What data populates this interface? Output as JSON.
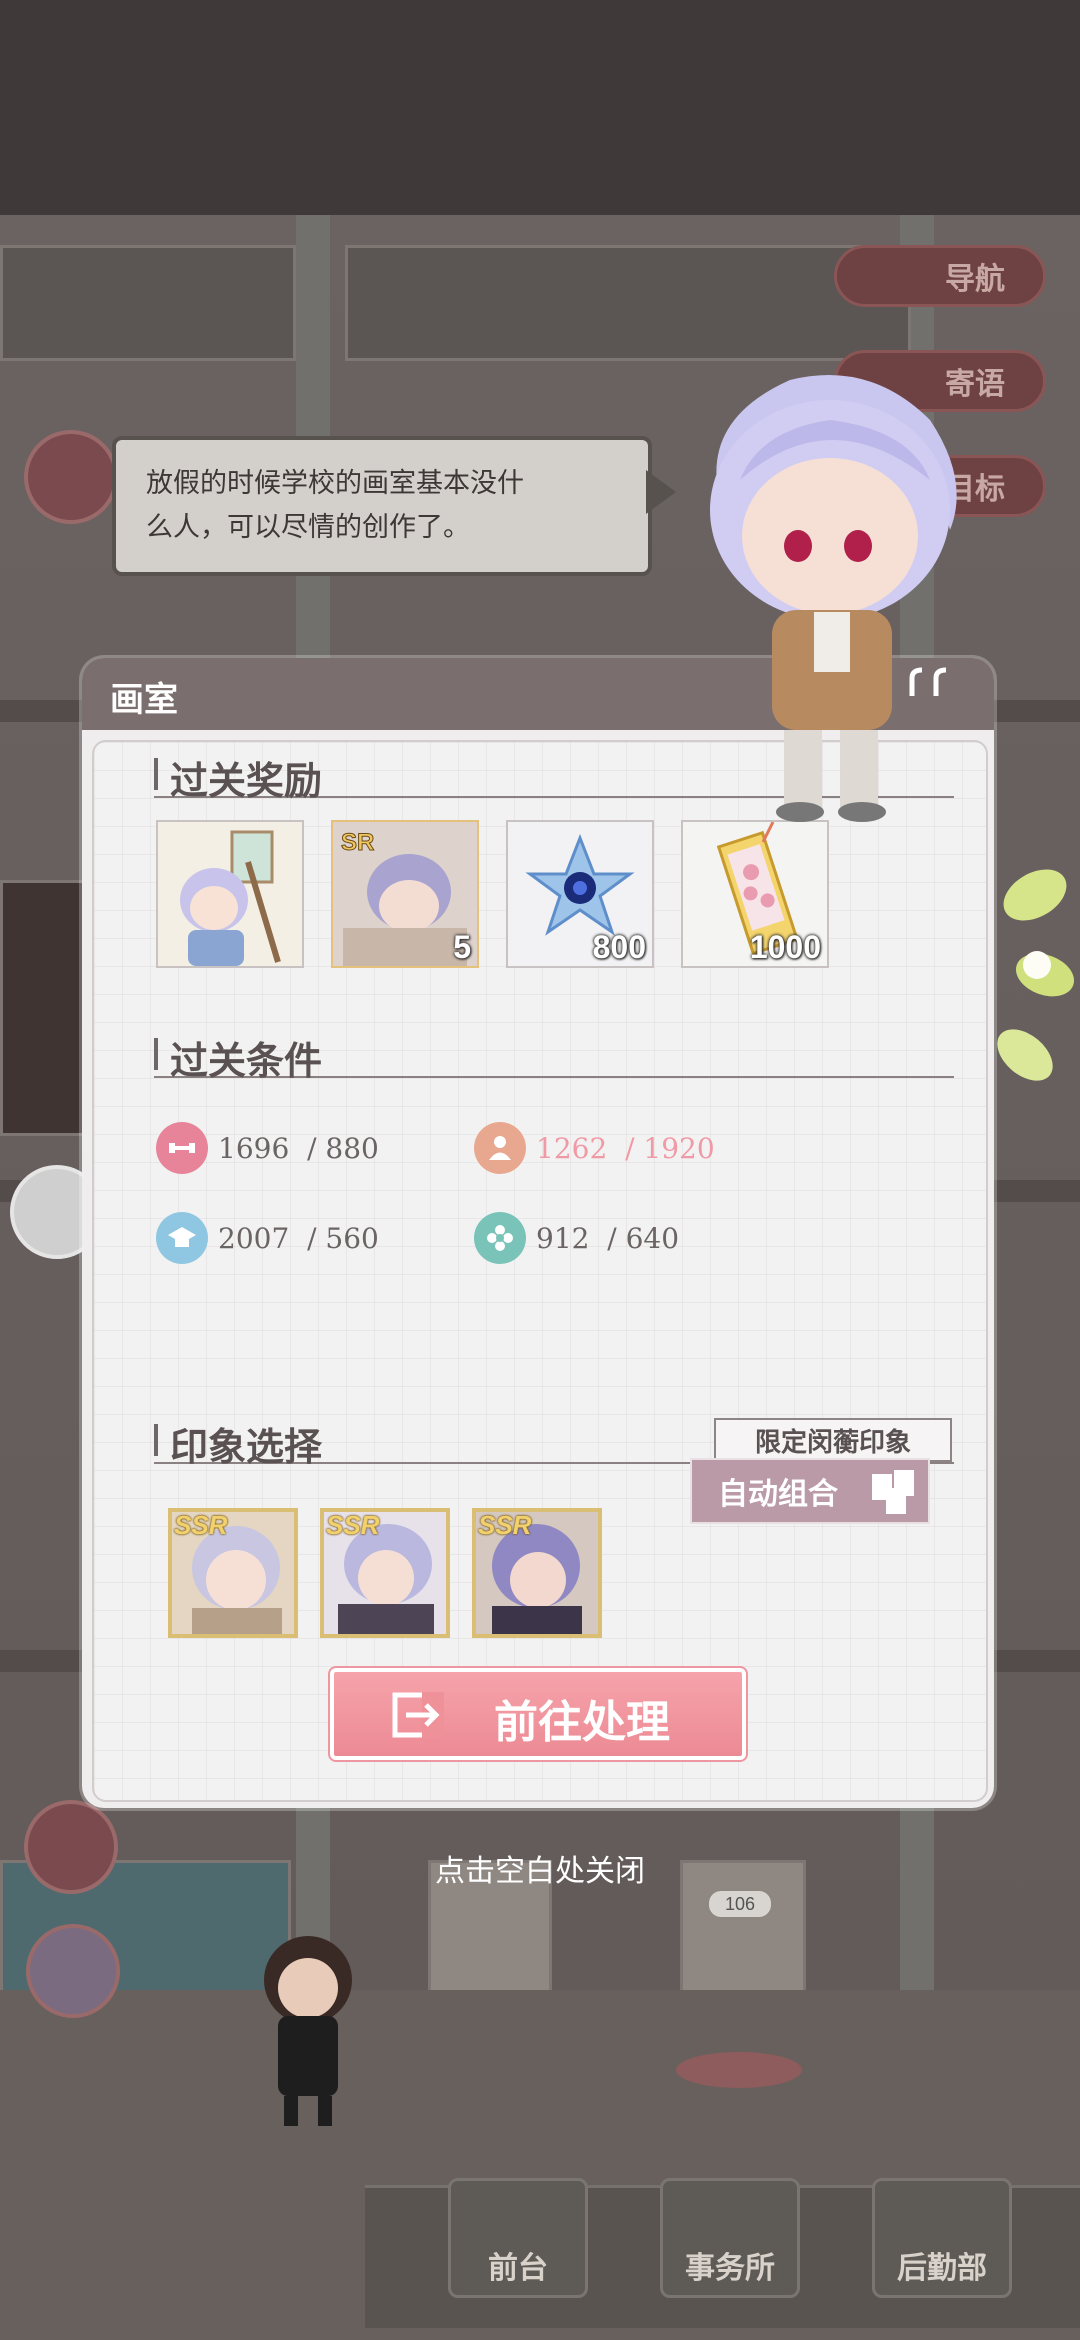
{
  "scene": {
    "side_buttons": [
      "导航",
      "寄语",
      "目标"
    ],
    "bottom_nav": [
      "前台",
      "事务所",
      "后勤部"
    ],
    "door_number": "106"
  },
  "speech": {
    "line1": "放假的时候学校的画室基本没什",
    "line2": "么人，可以尽情的创作了。"
  },
  "panel": {
    "title": "画室",
    "rewards_title": "过关奖励",
    "rewards": [
      {
        "icon": "character-painting-card",
        "count": ""
      },
      {
        "icon": "sr-card",
        "count": "5"
      },
      {
        "icon": "blue-crystal-flower",
        "count": "800"
      },
      {
        "icon": "bookmark-ticket",
        "count": "1000"
      }
    ],
    "conditions_title": "过关条件",
    "conditions": [
      {
        "icon": "dumbbell-icon",
        "current": "1696",
        "required": "/ 880",
        "met": true,
        "color": "#e8849a"
      },
      {
        "icon": "person-icon",
        "current": "1262",
        "required": "/ 1920",
        "met": false,
        "color": "#e8a890"
      },
      {
        "icon": "graduation-cap-icon",
        "current": "2007",
        "required": "/ 560",
        "met": true,
        "color": "#8fc6e2"
      },
      {
        "icon": "flower-icon",
        "current": "912",
        "required": "/ 640",
        "met": true,
        "color": "#79c3b8"
      }
    ],
    "impression_title": "印象选择",
    "limited_label": "限定闵蘅印象",
    "impressions": [
      {
        "rarity": "SSR"
      },
      {
        "rarity": "SSR"
      },
      {
        "rarity": "SSR"
      }
    ],
    "auto_button": "自动组合",
    "go_button": "前往处理"
  },
  "close_hint": "点击空白处关闭",
  "colors": {
    "panel_header": "#7a6e6e",
    "go_button": "#ec8a94",
    "warn_text": "#f09aa6"
  }
}
